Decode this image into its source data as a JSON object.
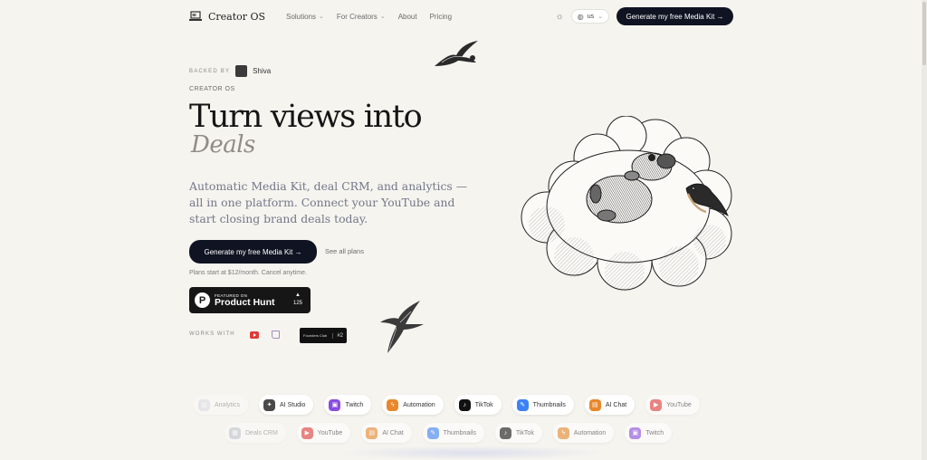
{
  "nav": {
    "brand": "Creator OS",
    "menu": [
      {
        "label": "Solutions",
        "has_dropdown": true
      },
      {
        "label": "For Creators",
        "has_dropdown": true
      },
      {
        "label": "About",
        "has_dropdown": false
      },
      {
        "label": "Pricing",
        "has_dropdown": false
      }
    ],
    "language": "us",
    "cta": "Generate my free Media Kit →"
  },
  "hero": {
    "backed_by_label": "BACKED BY",
    "backer_name": "Shiva",
    "eyebrow": "CREATOR OS",
    "headline": "Turn views into",
    "headline_italic": "Deals",
    "lead": "Automatic Media Kit, deal CRM, and analytics — all in one platform. Connect your YouTube and start closing brand deals today.",
    "cta": "Generate my free Media Kit →",
    "secondary_link": "See all plans",
    "pricing_note": "Plans start at $12/month. Cancel anytime."
  },
  "product_hunt": {
    "featured_label": "FEATURED ON",
    "name": "Product Hunt",
    "votes": "125"
  },
  "works_with": {
    "label": "WORKS WITH",
    "icons": [
      "youtube-icon",
      "twitch-icon"
    ],
    "badge_label": "Founders Club",
    "badge_rank": "#2"
  },
  "chips": {
    "row1": [
      {
        "label": "Analytics",
        "icon": "analytics-icon",
        "color": "#c9cbe0"
      },
      {
        "label": "AI Studio",
        "icon": "ai-studio-icon",
        "color": "#4a4a4a"
      },
      {
        "label": "Twitch",
        "icon": "twitch-icon",
        "color": "#8a4be0"
      },
      {
        "label": "Automation",
        "icon": "bolt-icon",
        "color": "#e8872b"
      },
      {
        "label": "TikTok",
        "icon": "tiktok-icon",
        "color": "#111111"
      },
      {
        "label": "Thumbnails",
        "icon": "brush-icon",
        "color": "#3b82f6"
      },
      {
        "label": "AI Chat",
        "icon": "chat-icon",
        "color": "#e8872b"
      },
      {
        "label": "YouTube",
        "icon": "youtube-icon",
        "color": "#e03a3a"
      }
    ],
    "row2": [
      {
        "label": "Deals CRM",
        "icon": "crm-icon",
        "color": "#9aa6b8"
      },
      {
        "label": "YouTube",
        "icon": "youtube-icon",
        "color": "#e03a3a"
      },
      {
        "label": "AI Chat",
        "icon": "chat-icon",
        "color": "#e8872b"
      },
      {
        "label": "Thumbnails",
        "icon": "brush-icon",
        "color": "#3b82f6"
      },
      {
        "label": "TikTok",
        "icon": "tiktok-icon",
        "color": "#111111"
      },
      {
        "label": "Automation",
        "icon": "bolt-icon",
        "color": "#e8872b"
      },
      {
        "label": "Twitch",
        "icon": "twitch-icon",
        "color": "#8a4be0"
      }
    ]
  }
}
